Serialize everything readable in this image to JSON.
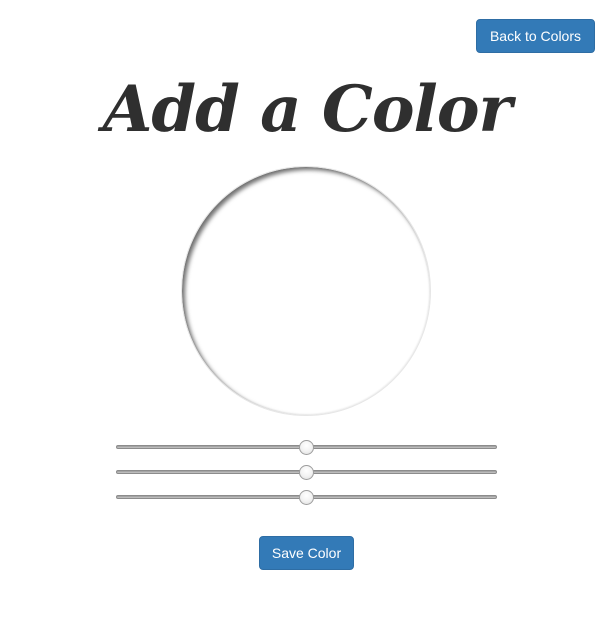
{
  "header": {
    "back_label": "Back to Colors"
  },
  "page": {
    "title": "Add a Color"
  },
  "preview": {
    "color": "#ffffff"
  },
  "sliders": [
    {
      "value": 0.5
    },
    {
      "value": 0.5
    },
    {
      "value": 0.5
    }
  ],
  "actions": {
    "save_label": "Save Color"
  },
  "colors": {
    "button": "#337ab7",
    "button_text": "#ffffff",
    "title": "#2f2f2f"
  }
}
